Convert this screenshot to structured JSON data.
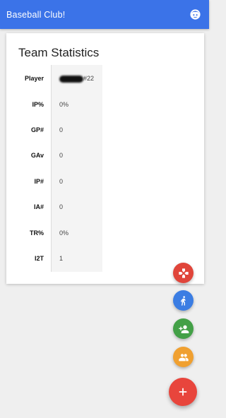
{
  "appbar": {
    "title": "Baseball Club!",
    "icon": "face-icon"
  },
  "card": {
    "title": "Team Statistics",
    "rows": [
      {
        "label": "Player",
        "value": "#22",
        "redacted_prefix": true
      },
      {
        "label": "IP%",
        "value": "0%"
      },
      {
        "label": "GP#",
        "value": "0"
      },
      {
        "label": "GAv",
        "value": "0"
      },
      {
        "label": "IP#",
        "value": "0"
      },
      {
        "label": "IA#",
        "value": "0"
      },
      {
        "label": "TR%",
        "value": "0%"
      },
      {
        "label": "I2T",
        "value": "1"
      }
    ]
  },
  "fabs": [
    {
      "name": "game-fab",
      "icon": "gamepad-icon",
      "color": "#e0453a"
    },
    {
      "name": "walk-fab",
      "icon": "walk-icon",
      "color": "#3b7de3"
    },
    {
      "name": "add-person-fab",
      "icon": "person-add-icon",
      "color": "#43a047"
    },
    {
      "name": "group-fab",
      "icon": "group-icon",
      "color": "#f0a030"
    },
    {
      "name": "add-fab",
      "icon": "plus-icon",
      "color": "#e8453c"
    }
  ]
}
